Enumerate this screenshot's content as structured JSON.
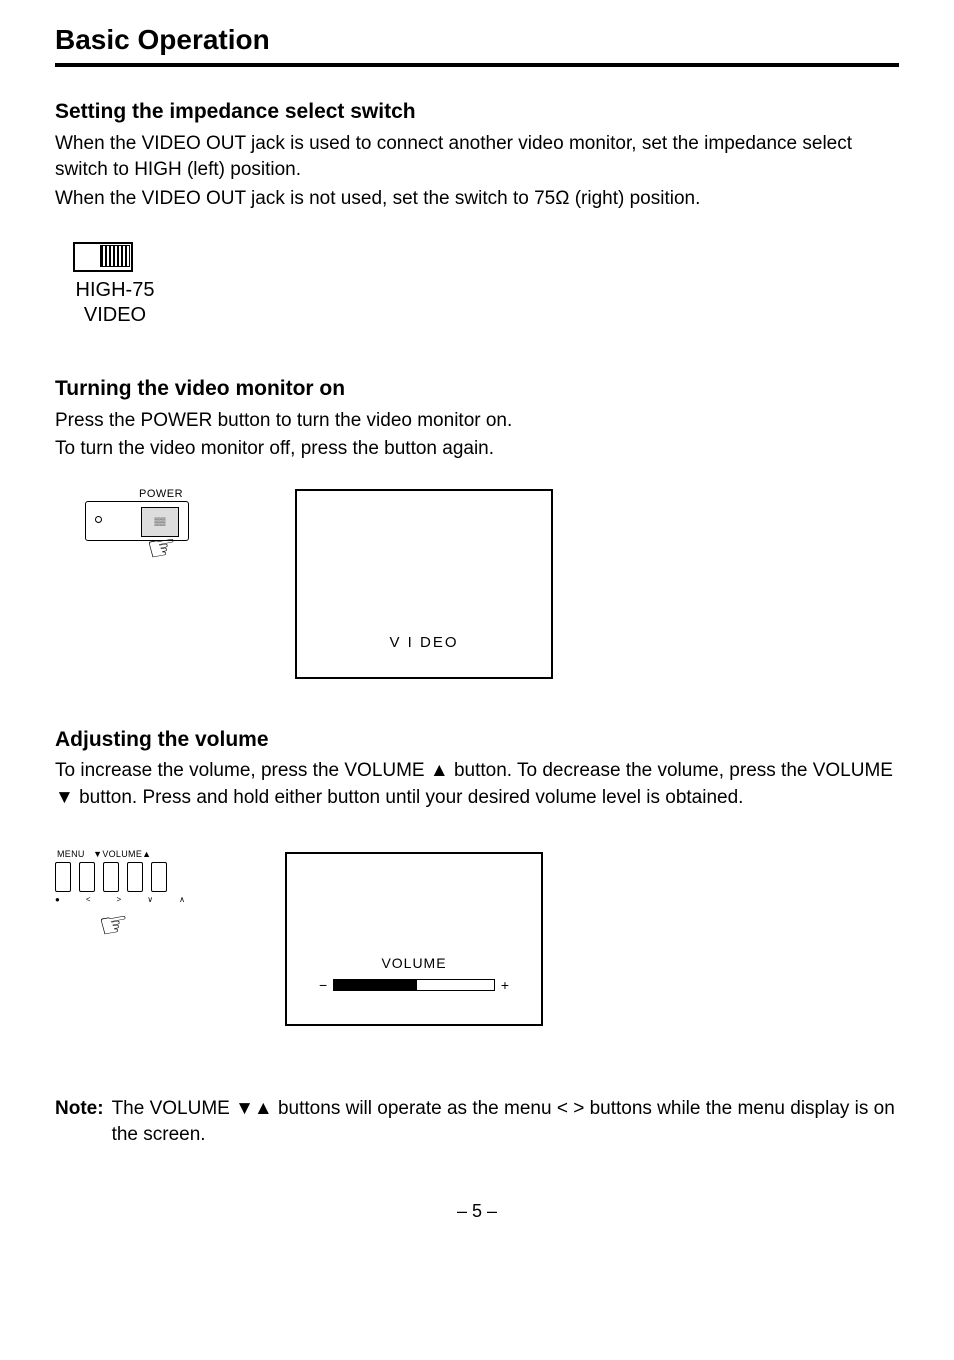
{
  "page_title": "Basic Operation",
  "section1": {
    "heading": "Setting the impedance select switch",
    "para1": "When the VIDEO OUT jack is used to connect another video monitor, set the impedance select switch to HIGH (left) position.",
    "para2": "When the VIDEO OUT jack is not used, set the switch to 75Ω (right) position.",
    "switch_label1": "HIGH-75",
    "switch_label2": "VIDEO"
  },
  "section2": {
    "heading": "Turning the video monitor on",
    "para1": "Press the POWER button to turn the video monitor on.",
    "para2": "To turn the video monitor off, press the button again.",
    "power_label": "POWER",
    "screen_text": "V I DEO"
  },
  "section3": {
    "heading": "Adjusting the volume",
    "para1": "To increase the volume, press the VOLUME ▲ button. To decrease the volume, press the VOLUME ▼ button. Press and hold either button until your desired volume level is obtained.",
    "tiny_menu": "MENU",
    "tiny_vol": "▼VOLUME▲",
    "screen_label": "VOLUME",
    "minus": "−",
    "plus": "+"
  },
  "note": {
    "label": "Note:",
    "text": "The VOLUME ▼▲ buttons will operate as the menu < > buttons while the menu display is on the screen."
  },
  "page_number": "– 5 –"
}
